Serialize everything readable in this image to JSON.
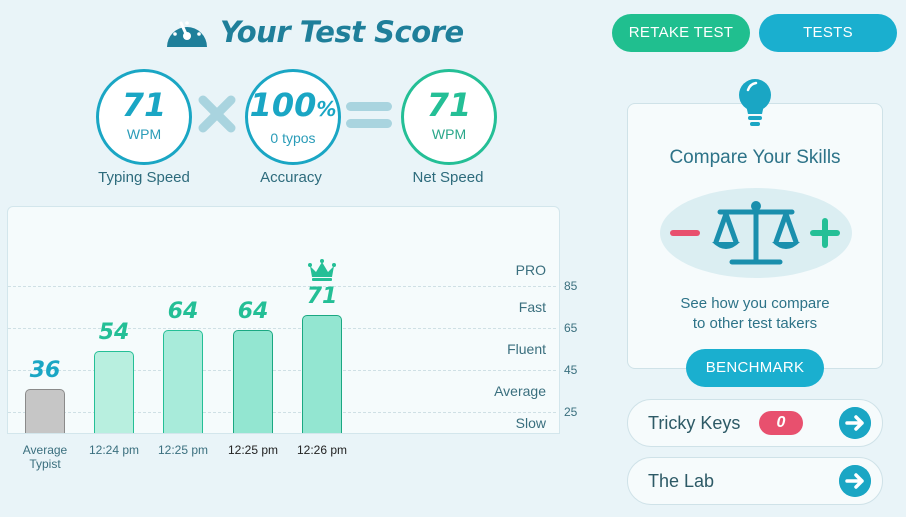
{
  "header": {
    "title": "Your Test Score",
    "icon": "speedometer-icon"
  },
  "stats": {
    "speed": {
      "value": "71",
      "unit": "WPM",
      "caption": "Typing Speed"
    },
    "accuracy": {
      "value": "100",
      "percent_sign": "%",
      "sub": "0  typos",
      "caption": "Accuracy"
    },
    "net": {
      "value": "71",
      "unit": "WPM",
      "caption": "Net Speed"
    }
  },
  "actions": {
    "retake_label": "RETAKE TEST",
    "tests_label": "TESTS"
  },
  "colors": {
    "primary_blue": "#1aa6c4",
    "green": "#24bf96",
    "red_badge": "#e8506e",
    "background": "#e9f4f8"
  },
  "chart_data": {
    "type": "bar",
    "categories": [
      "Average Typist",
      "12:24 pm",
      "12:25 pm",
      "12:25 pm",
      "12:26 pm"
    ],
    "values": [
      36,
      54,
      64,
      64,
      71
    ],
    "value_labels": [
      "36",
      "54",
      "64",
      "64",
      "71"
    ],
    "levels": [
      "PRO",
      "Fast",
      "Fluent",
      "Average",
      "Slow"
    ],
    "y_ticks": [
      "85",
      "65",
      "45",
      "25"
    ],
    "ylim": [
      15,
      100
    ],
    "best_marker": "crown-icon",
    "grid": true
  },
  "compare": {
    "title": "Compare Your Skills",
    "description_line1": "See how you compare",
    "description_line2": "to other test takers",
    "benchmark_label": "BENCHMARK"
  },
  "links": {
    "tricky_keys_label": "Tricky Keys",
    "tricky_keys_count": "0",
    "lab_label": "The Lab"
  }
}
